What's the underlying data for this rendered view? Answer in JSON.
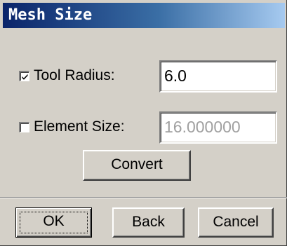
{
  "dialog": {
    "title": "Mesh Size"
  },
  "tool_radius": {
    "label": "Tool Radius:",
    "checked": true,
    "value": "6.0"
  },
  "element_size": {
    "label": "Element Size:",
    "checked": false,
    "value": "16.000000"
  },
  "buttons": {
    "convert": "Convert",
    "ok": "OK",
    "back": "Back",
    "cancel": "Cancel"
  },
  "colors": {
    "title_gradient_start": "#0a246a",
    "title_gradient_end": "#a6caf0",
    "face": "#d4d0c8",
    "disabled_text": "#a0a0a0"
  }
}
